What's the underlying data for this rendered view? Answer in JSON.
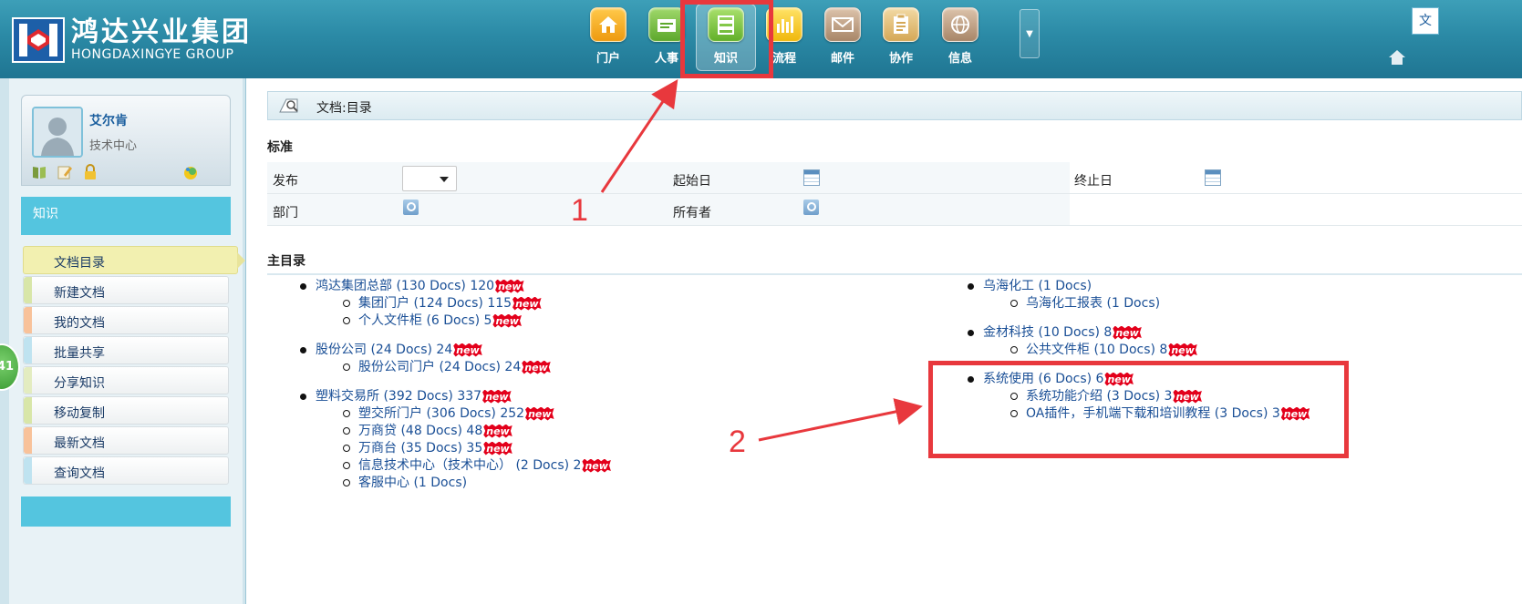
{
  "header": {
    "logo_cn": "鸿达兴业集团",
    "logo_en": "HONGDAXINGYE GROUP",
    "nav": [
      {
        "label": "门户",
        "icon": "home-icon",
        "color": "#f2a51d"
      },
      {
        "label": "人事",
        "icon": "personnel-icon",
        "color": "#7cc243"
      },
      {
        "label": "知识",
        "icon": "knowledge-icon",
        "color": "#8ccf4a",
        "active": true
      },
      {
        "label": "流程",
        "icon": "chart-icon",
        "color": "#f5c31b"
      },
      {
        "label": "邮件",
        "icon": "mail-icon",
        "color": "#c8a98d"
      },
      {
        "label": "协作",
        "icon": "clipboard-icon",
        "color": "#e9c680"
      },
      {
        "label": "信息",
        "icon": "globe-icon",
        "color": "#c8a98d"
      }
    ],
    "top_right_text": "文"
  },
  "sidebar": {
    "user_name": "艾尔肯",
    "user_dept": "技术中心",
    "section_title": "知识",
    "side_badge": "41",
    "menu": [
      {
        "label": "文档目录",
        "stripe": "#f2f0b0",
        "active": true
      },
      {
        "label": "新建文档",
        "stripe": "#d8e6a8"
      },
      {
        "label": "我的文档",
        "stripe": "#f8c29a"
      },
      {
        "label": "批量共享",
        "stripe": "#bfe3f0"
      },
      {
        "label": "分享知识",
        "stripe": "#e3ecc0"
      },
      {
        "label": "移动复制",
        "stripe": "#d8e6a8"
      },
      {
        "label": "最新文档",
        "stripe": "#f8c29a"
      },
      {
        "label": "查询文档",
        "stripe": "#bfe3f0"
      }
    ]
  },
  "main": {
    "breadcrumb": "文档:目录",
    "standard_title": "标准",
    "form": {
      "publish_label": "发布",
      "start_date_label": "起始日",
      "end_date_label": "终止日",
      "dept_label": "部门",
      "owner_label": "所有者"
    },
    "main_dir_title": "主目录",
    "new_badge": "new",
    "left_tree": [
      {
        "label": "鸿达集团总部",
        "docs": "(130 Docs)",
        "count": "120",
        "new": true,
        "children": [
          {
            "label": "集团门户",
            "docs": "(124 Docs)",
            "count": "115",
            "new": true
          },
          {
            "label": "个人文件柜",
            "docs": "(6 Docs)",
            "count": "5",
            "new": true
          }
        ]
      },
      {
        "label": "股份公司",
        "docs": "(24 Docs)",
        "count": "24",
        "new": true,
        "children": [
          {
            "label": "股份公司门户",
            "docs": "(24 Docs)",
            "count": "24",
            "new": true
          }
        ]
      },
      {
        "label": "塑料交易所",
        "docs": "(392 Docs)",
        "count": "337",
        "new": true,
        "children": [
          {
            "label": "塑交所门户",
            "docs": "(306 Docs)",
            "count": "252",
            "new": true
          },
          {
            "label": "万商贷",
            "docs": "(48 Docs)",
            "count": "48",
            "new": true
          },
          {
            "label": "万商台",
            "docs": "(35 Docs)",
            "count": "35",
            "new": true
          },
          {
            "label": "信息技术中心（技术中心）",
            "docs": "(2 Docs)",
            "count": "2",
            "new": true
          },
          {
            "label": "客服中心",
            "docs": "(1 Docs)",
            "count": "",
            "new": false
          }
        ]
      }
    ],
    "right_tree": [
      {
        "label": "乌海化工",
        "docs": "(1 Docs)",
        "count": "",
        "new": false,
        "children": [
          {
            "label": "乌海化工报表",
            "docs": "(1 Docs)",
            "count": "",
            "new": false
          }
        ]
      },
      {
        "label": "金材科技",
        "docs": "(10 Docs)",
        "count": "8",
        "new": true,
        "children": [
          {
            "label": "公共文件柜",
            "docs": "(10 Docs)",
            "count": "8",
            "new": true
          }
        ]
      },
      {
        "label": "系统使用",
        "docs": "(6 Docs)",
        "count": "6",
        "new": true,
        "children": [
          {
            "label": "系统功能介绍",
            "docs": "(3 Docs)",
            "count": "3",
            "new": true
          },
          {
            "label": "OA插件，手机端下载和培训教程",
            "docs": "(3 Docs)",
            "count": "3",
            "new": true
          }
        ]
      }
    ]
  },
  "annotations": {
    "label_1": "1",
    "label_2": "2",
    "color": "#e8383d"
  }
}
